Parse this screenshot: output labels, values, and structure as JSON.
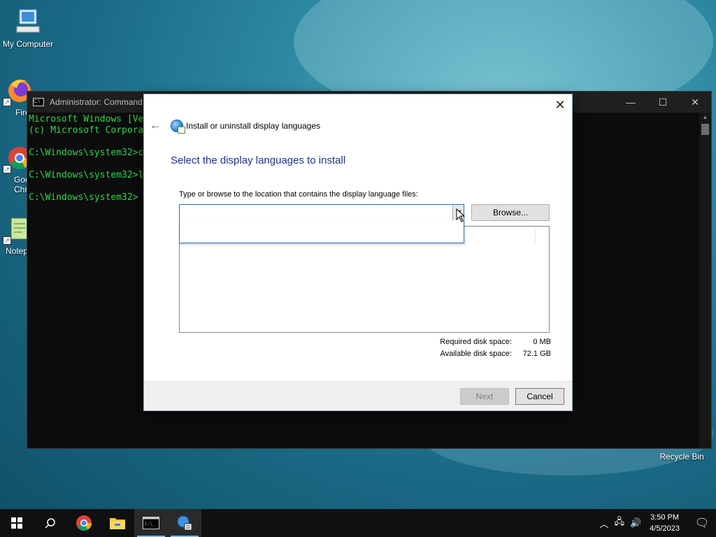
{
  "desktop": {
    "icons": [
      {
        "label": "My Computer",
        "icon": "computer-icon"
      },
      {
        "label": "Fire",
        "icon": "firefox-icon"
      },
      {
        "label": "Goo Chro",
        "icon": "chrome-icon"
      },
      {
        "label": "Notep",
        "icon": "notepad-icon"
      },
      {
        "label": "Recycle Bin",
        "icon": "recycle-bin-icon"
      }
    ]
  },
  "console": {
    "title": "Administrator: Command",
    "lines": [
      "Microsoft Windows [Ve",
      "(c) Microsoft Corpora",
      "",
      "C:\\Windows\\system32>c",
      "",
      "C:\\Windows\\system32>l",
      "",
      "C:\\Windows\\system32>"
    ],
    "controls": {
      "minimize": "—",
      "maximize": "☐",
      "close": "✕"
    }
  },
  "dialog": {
    "title": "Install or uninstall display languages",
    "heading": "Select the display languages to install",
    "instruction": "Type or browse to the location that contains the display language files:",
    "path_value": "",
    "browse_label": "Browse...",
    "required_label": "Required disk space:",
    "required_value": "0 MB",
    "available_label": "Available disk space:",
    "available_value": "72.1 GB",
    "next_label": "Next",
    "cancel_label": "Cancel",
    "close_glyph": "✕",
    "back_glyph": "←"
  },
  "taskbar": {
    "items": [
      "start-icon",
      "search-icon",
      "chrome-icon",
      "file-explorer-icon",
      "command-prompt-icon",
      "language-settings-icon"
    ],
    "time": "3:50 PM",
    "date": "4/5/2023"
  }
}
